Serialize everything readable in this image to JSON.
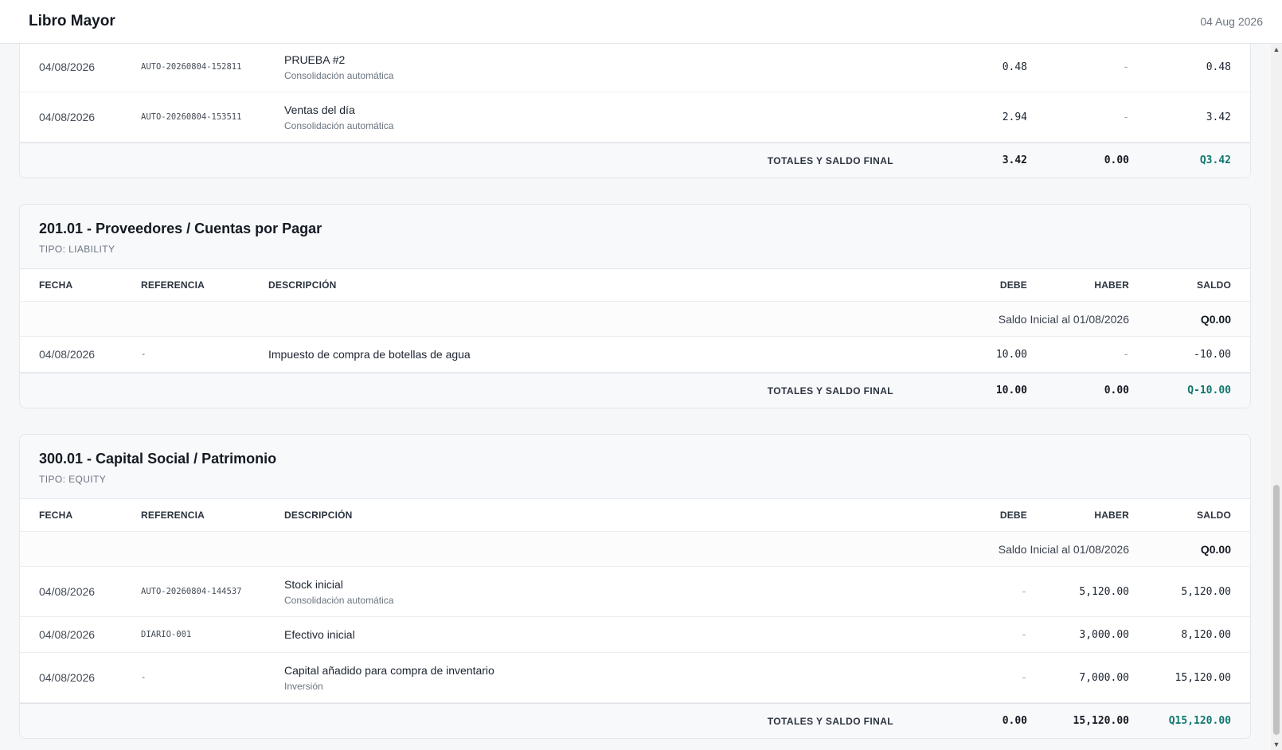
{
  "header": {
    "title": "Libro Mayor",
    "date": "04 Aug 2026"
  },
  "columns": {
    "fecha": "FECHA",
    "referencia": "REFERENCIA",
    "descripcion": "DESCRIPCIÓN",
    "debe": "DEBE",
    "haber": "HABER",
    "saldo": "SALDO"
  },
  "accounts": [
    {
      "rows": [
        {
          "fecha": "04/08/2026",
          "ref": "AUTO-20260804-152811",
          "desc": "PRUEBA #2",
          "sub": "Consolidación automática",
          "debe": "0.48",
          "haber": "-",
          "saldo": "0.48"
        },
        {
          "fecha": "04/08/2026",
          "ref": "AUTO-20260804-153511",
          "desc": "Ventas del día",
          "sub": "Consolidación automática",
          "debe": "2.94",
          "haber": "-",
          "saldo": "3.42"
        }
      ],
      "totals": {
        "label": "TOTALES Y SALDO FINAL",
        "debe": "3.42",
        "haber": "0.00",
        "saldo": "Q3.42"
      }
    },
    {
      "name": "201.01 - Proveedores / Cuentas por Pagar",
      "type": "TIPO: LIABILITY",
      "initial": {
        "label": "Saldo Inicial al 01/08/2026",
        "value": "Q0.00"
      },
      "rows": [
        {
          "fecha": "04/08/2026",
          "ref": "-",
          "desc": "Impuesto de compra de botellas de agua",
          "debe": "10.00",
          "haber": "-",
          "saldo": "-10.00"
        }
      ],
      "totals": {
        "label": "TOTALES Y SALDO FINAL",
        "debe": "10.00",
        "haber": "0.00",
        "saldo": "Q-10.00"
      }
    },
    {
      "name": "300.01 - Capital Social / Patrimonio",
      "type": "TIPO: EQUITY",
      "initial": {
        "label": "Saldo Inicial al 01/08/2026",
        "value": "Q0.00"
      },
      "rows": [
        {
          "fecha": "04/08/2026",
          "ref": "AUTO-20260804-144537",
          "desc": "Stock inicial",
          "sub": "Consolidación automática",
          "debe": "-",
          "haber": "5,120.00",
          "saldo": "5,120.00"
        },
        {
          "fecha": "04/08/2026",
          "ref": "DIARIO-001",
          "desc": "Efectivo inicial",
          "debe": "-",
          "haber": "3,000.00",
          "saldo": "8,120.00"
        },
        {
          "fecha": "04/08/2026",
          "ref": "-",
          "desc": "Capital añadido para compra de inventario",
          "sub": "Inversión",
          "debe": "-",
          "haber": "7,000.00",
          "saldo": "15,120.00"
        }
      ],
      "totals": {
        "label": "TOTALES Y SALDO FINAL",
        "debe": "0.00",
        "haber": "15,120.00",
        "saldo": "Q15,120.00"
      }
    }
  ]
}
